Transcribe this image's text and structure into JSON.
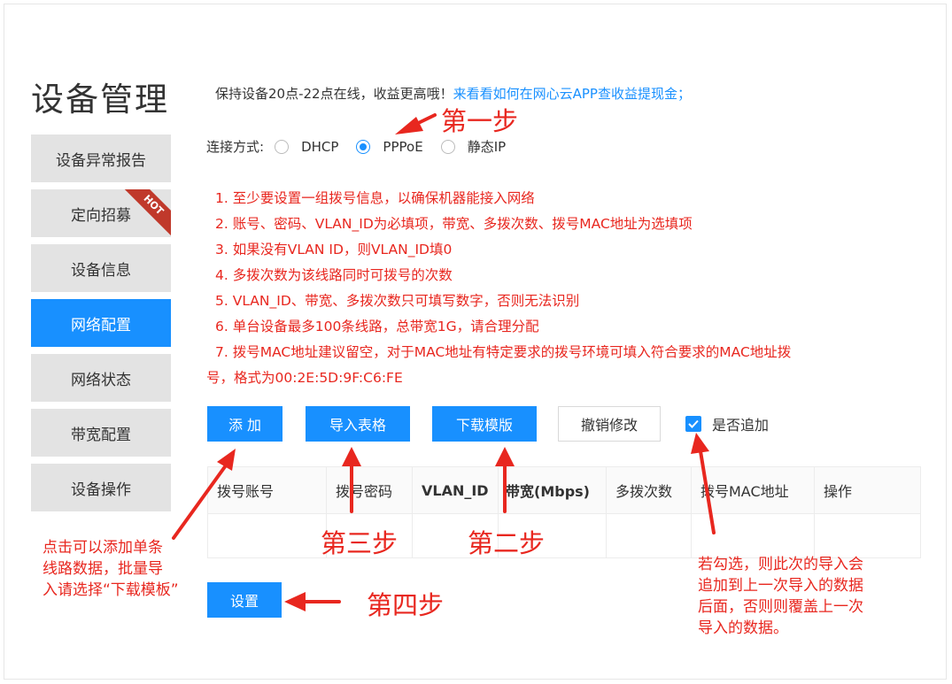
{
  "page_title": "设备管理",
  "sidebar": {
    "items": [
      {
        "label": "设备异常报告"
      },
      {
        "label": "定向招募",
        "badge": "HOT"
      },
      {
        "label": "设备信息"
      },
      {
        "label": "网络配置",
        "active": true
      },
      {
        "label": "网络状态"
      },
      {
        "label": "带宽配置"
      },
      {
        "label": "设备操作"
      }
    ]
  },
  "promo": {
    "text": "保持设备20点-22点在线，收益更高哦！",
    "link": "来看看如何在网心云APP查收益提现金；"
  },
  "connection": {
    "label": "连接方式:",
    "options": [
      "DHCP",
      "PPPoE",
      "静态IP"
    ],
    "selected": "PPPoE"
  },
  "notes": [
    "1. 至少要设置一组拨号信息，以确保机器能接入网络",
    "2. 账号、密码、VLAN_ID为必填项，带宽、多拨次数、拨号MAC地址为选填项",
    "3. 如果没有VLAN ID，则VLAN_ID填0",
    "4. 多拨次数为该线路同时可拨号的次数",
    "5. VLAN_ID、带宽、多拨次数只可填写数字，否则无法识别",
    "6. 单台设备最多100条线路，总带宽1G，请合理分配",
    "7. 拨号MAC地址建议留空，对于MAC地址有特定要求的拨号环境可填入符合要求的MAC地址拨",
    "号，格式为00:2E:5D:9F:C6:FE"
  ],
  "toolbar": {
    "add": "添 加",
    "import": "导入表格",
    "download": "下载模版",
    "revert": "撤销修改",
    "append_label": "是否追加",
    "append_checked": true
  },
  "table": {
    "headers": [
      "拨号账号",
      "拨号密码",
      "VLAN_ID",
      "带宽(Mbps)",
      "多拨次数",
      "拨号MAC地址",
      "操作"
    ]
  },
  "submit_label": "设置",
  "annotations": {
    "step1": "第一步",
    "step2": "第二步",
    "step3": "第三步",
    "step4": "第四步",
    "add_note": [
      "点击可以添加单条",
      "线路数据，批量导",
      "入请选择“下载模板”"
    ],
    "append_note": [
      "若勾选，则此次的导入会",
      "追加到上一次导入的数据",
      "后面，否则则覆盖上一次",
      "导入的数据。"
    ]
  },
  "colors": {
    "accent": "#1890ff",
    "annotation": "#e8271f",
    "hot": "#c0392b"
  }
}
